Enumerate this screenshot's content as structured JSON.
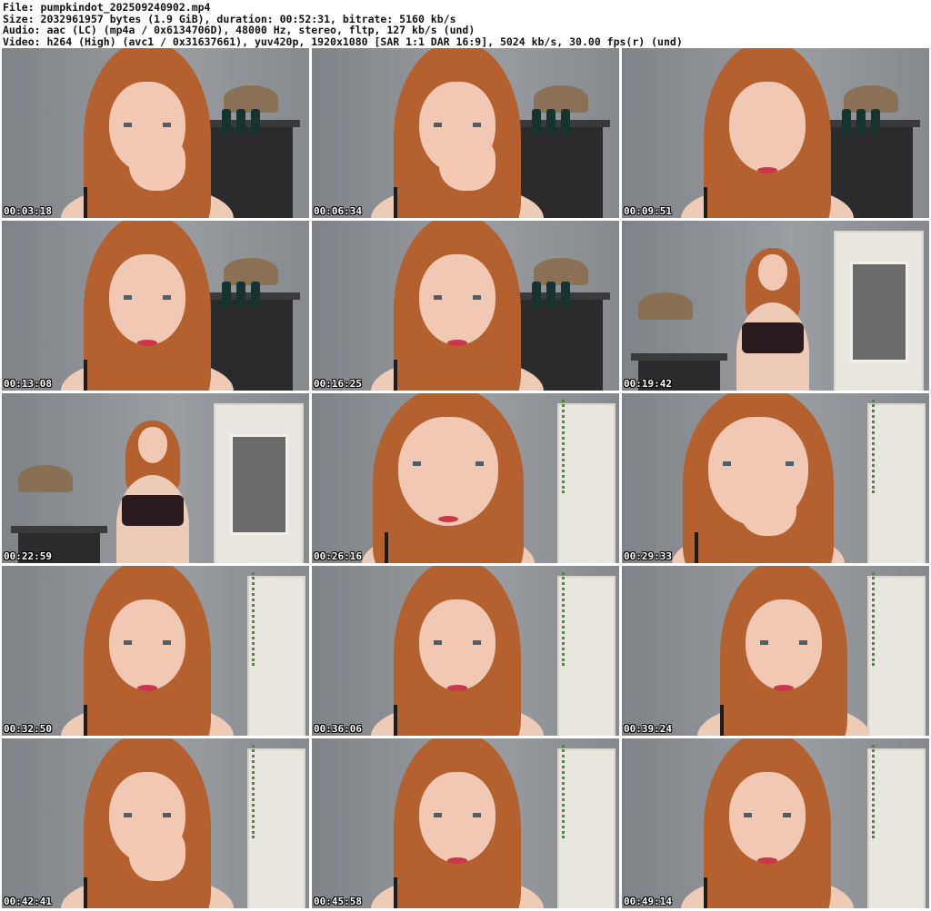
{
  "header": {
    "file": "File: pumpkindot_202509240902.mp4",
    "size": "Size: 2032961957 bytes (1.9 GiB), duration: 00:52:31, bitrate: 5160 kb/s",
    "audio": "Audio: aac (LC) (mp4a / 0x6134706D), 48000 Hz, stereo, fltp, 127 kb/s (und)",
    "video": "Video: h264 (High) (avc1 / 0x31637661), yuv420p, 1920x1080 [SAR 1:1 DAR 16:9], 5024 kb/s, 30.00 fps(r) (und)"
  },
  "thumbnails": [
    {
      "timestamp": "00:03:18",
      "scene": "closeup-hand-face"
    },
    {
      "timestamp": "00:06:34",
      "scene": "closeup-hand-hair"
    },
    {
      "timestamp": "00:09:51",
      "scene": "closeup-eyes-closed"
    },
    {
      "timestamp": "00:13:08",
      "scene": "closeup"
    },
    {
      "timestamp": "00:16:25",
      "scene": "closeup-looking-down"
    },
    {
      "timestamp": "00:19:42",
      "scene": "standing-door"
    },
    {
      "timestamp": "00:22:59",
      "scene": "standing-door"
    },
    {
      "timestamp": "00:26:16",
      "scene": "closeup-large"
    },
    {
      "timestamp": "00:29:33",
      "scene": "closeup-hand-mouth"
    },
    {
      "timestamp": "00:32:50",
      "scene": "closeup"
    },
    {
      "timestamp": "00:36:06",
      "scene": "closeup"
    },
    {
      "timestamp": "00:39:24",
      "scene": "closeup-bright"
    },
    {
      "timestamp": "00:42:41",
      "scene": "closeup-hands-face"
    },
    {
      "timestamp": "00:45:58",
      "scene": "closeup"
    },
    {
      "timestamp": "00:49:14",
      "scene": "closeup"
    }
  ]
}
